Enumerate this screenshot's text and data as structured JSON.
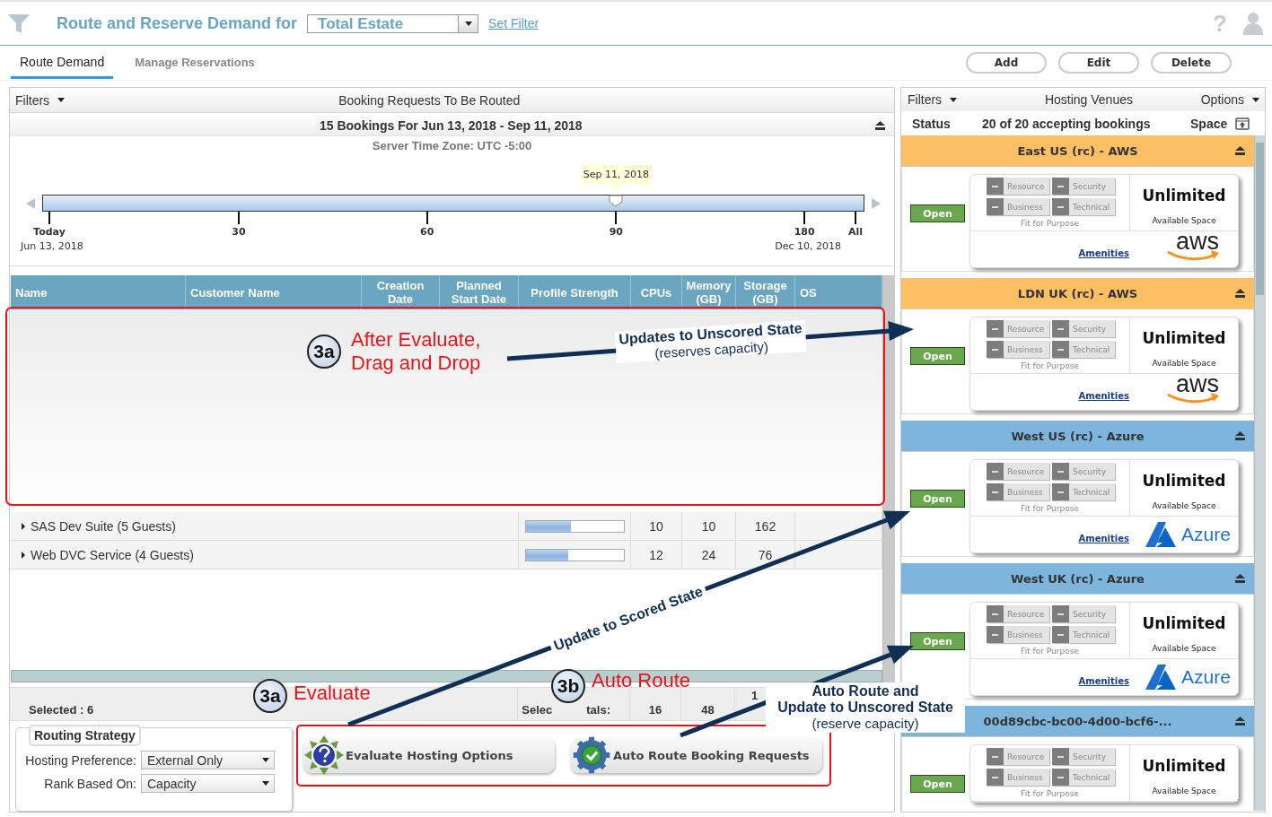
{
  "header": {
    "title": "Route and Reserve Demand for",
    "estate_select": "Total Estate",
    "set_filter_link": "Set Filter",
    "help": "?"
  },
  "tabs": [
    {
      "label": "Route Demand",
      "selected": true
    },
    {
      "label": "Manage Reservations",
      "selected": false
    }
  ],
  "actions": [
    "Add",
    "Edit",
    "Delete"
  ],
  "bookings": {
    "filters_label": "Filters",
    "title": "Booking Requests To Be Routed",
    "summary": "15 Bookings For Jun 13, 2018 - Sep 11, 2018",
    "time_zone": "Server Time Zone: UTC -5:00",
    "timeline": {
      "tooltip": "Sep 11, 2018",
      "level": 0.698,
      "ticks": [
        "Today",
        "30",
        "60",
        "90",
        "180",
        "All"
      ],
      "start_date": "Jun 13, 2018",
      "end_date": "Dec 10, 2018"
    },
    "columns": [
      "Name",
      "Customer Name",
      "Creation Date",
      "Planned Start Date",
      "Profile Strength",
      "CPUs",
      "Memory (GB)",
      "Storage (GB)",
      "OS"
    ],
    "rows": [
      {
        "name": "SAS Dev Suite (5 Guests)",
        "expanded": false,
        "profile_strength": {
          "level": 0.46
        },
        "cpus": "10",
        "memory": "10",
        "storage": "162"
      },
      {
        "name": "Web DVC Service (4 Guests)",
        "expanded": false,
        "profile_strength": {
          "level": 0.44
        },
        "cpus": "12",
        "memory": "24",
        "storage": "76"
      }
    ],
    "footer": {
      "selected": "Selected : 6",
      "totals_label_parts": [
        "Selec",
        "tals:"
      ],
      "totals": [
        "16",
        "48",
        "1"
      ]
    },
    "routing_strategy": {
      "title": "Routing Strategy",
      "fields": [
        {
          "label": "Hosting Preference:",
          "value": "External Only"
        },
        {
          "label": "Rank Based On:",
          "value": "Capacity"
        }
      ]
    },
    "buttons": [
      {
        "kind": "evaluate",
        "label": "Evaluate Hosting Options"
      },
      {
        "kind": "auto_route",
        "label": "Auto Route Booking Requests"
      }
    ]
  },
  "venues": {
    "filters_label": "Filters",
    "title": "Hosting Venues",
    "options_label": "Options",
    "status_label": "Status",
    "summary": "20 of 20 accepting bookings",
    "space_label": "Space",
    "items": [
      {
        "name": "East US (rc) - AWS",
        "color": "#fdbf63",
        "status": "Open",
        "tags": [
          "Resource",
          "Security",
          "Business",
          "Technical"
        ],
        "fit_label": "Fit for Purpose",
        "space": "Unlimited",
        "space_label": "Available Space",
        "amenities": "Amenities",
        "provider": {
          "kind": "aws",
          "label": "aws"
        }
      },
      {
        "name": "LDN UK (rc) - AWS",
        "color": "#fdbf63",
        "status": "Open",
        "tags": [
          "Resource",
          "Security",
          "Business",
          "Technical"
        ],
        "fit_label": "Fit for Purpose",
        "space": "Unlimited",
        "space_label": "Available Space",
        "amenities": "Amenities",
        "provider": {
          "kind": "aws",
          "label": "aws"
        }
      },
      {
        "name": "West US (rc) - Azure",
        "color": "#7eb5dc",
        "status": "Open",
        "tags": [
          "Resource",
          "Security",
          "Business",
          "Technical"
        ],
        "fit_label": "Fit for Purpose",
        "space": "Unlimited",
        "space_label": "Available Space",
        "amenities": "Amenities",
        "provider": {
          "kind": "azure",
          "label": "Azure"
        }
      },
      {
        "name": "West UK (rc) - Azure",
        "color": "#7eb5dc",
        "status": "Open",
        "tags": [
          "Resource",
          "Security",
          "Business",
          "Technical"
        ],
        "fit_label": "Fit for Purpose",
        "space": "Unlimited",
        "space_label": "Available Space",
        "amenities": "Amenities",
        "provider": {
          "kind": "azure",
          "label": "Azure"
        }
      },
      {
        "name": "00d89cbc-bc00-4d00-bcf6-...",
        "color": "#7eb5dc",
        "status": "Open",
        "tags": [
          "Resource",
          "Security",
          "Business",
          "Technical"
        ],
        "fit_label": "Fit for Purpose",
        "space": "Unlimited",
        "space_label": "Available Space"
      }
    ]
  },
  "annotations": [
    {
      "kind": "step",
      "badge": "3a",
      "text": "After Evaluate,\nDrag and Drop"
    },
    {
      "kind": "step",
      "badge": "3a",
      "text": "Evaluate"
    },
    {
      "kind": "step",
      "badge": "3b",
      "text": "Auto Route"
    },
    {
      "kind": "arrow_label",
      "lines": [
        "Updates to Unscored State",
        "(reserves capacity)"
      ]
    },
    {
      "kind": "arrow_label",
      "lines": [
        "Update to Scored State"
      ]
    },
    {
      "kind": "callout",
      "lines": [
        "Auto Route and",
        "Update to Unscored State",
        "(reserve capacity)"
      ]
    }
  ]
}
